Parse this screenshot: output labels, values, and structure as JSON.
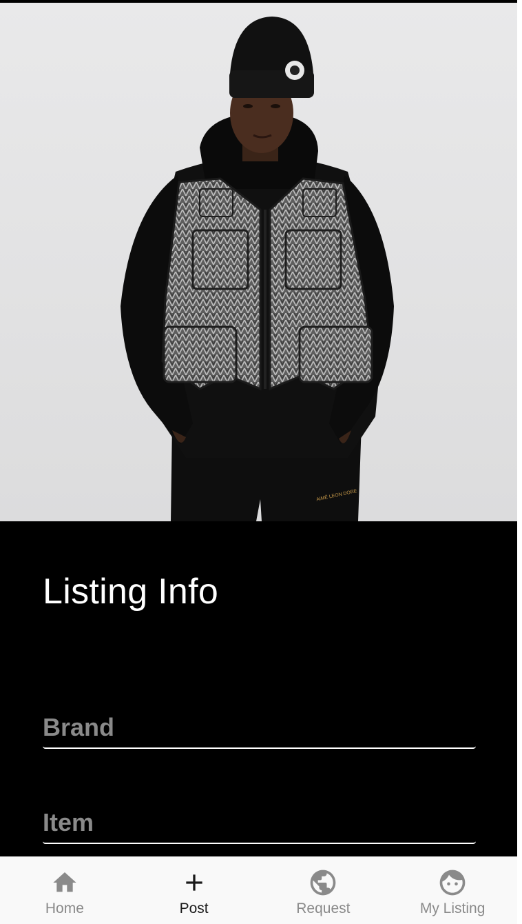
{
  "hero": {
    "image": "model wearing black beanie, black hoodie, grey herringbone utility vest and black sweatpants",
    "pants_logo_text": "AIMÉ LEON DORE"
  },
  "listing": {
    "title": "Listing Info",
    "fields": [
      {
        "name": "brand",
        "placeholder": "Brand",
        "value": ""
      },
      {
        "name": "item",
        "placeholder": "Item",
        "value": ""
      }
    ]
  },
  "nav": {
    "items": [
      {
        "label": "Home",
        "icon": "home-icon",
        "active": false
      },
      {
        "label": "Post",
        "icon": "plus-icon",
        "active": true
      },
      {
        "label": "Request",
        "icon": "globe-icon",
        "active": false
      },
      {
        "label": "My Listing",
        "icon": "face-icon",
        "active": false
      }
    ]
  },
  "colors": {
    "panel_background": "#000000",
    "nav_background": "#f9f9f9",
    "nav_inactive": "#8a8a8a",
    "nav_active": "#1a1a1a",
    "placeholder": "#8a8a8a",
    "title_text": "#ffffff"
  }
}
